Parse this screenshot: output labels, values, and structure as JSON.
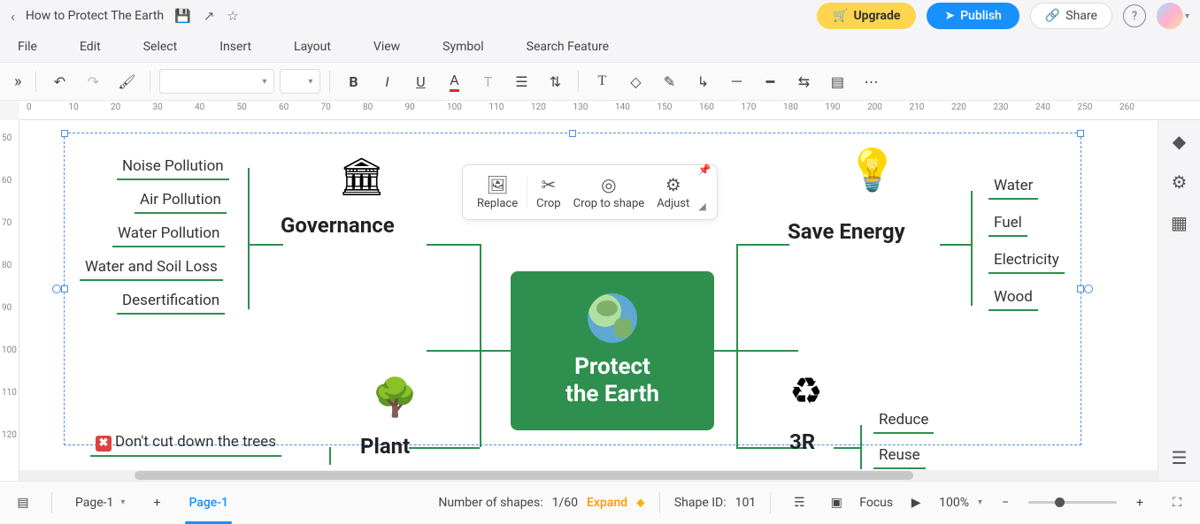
{
  "titlebar": {
    "doc_title": "How to Protect The Earth",
    "upgrade": "Upgrade",
    "publish": "Publish",
    "share": "Share"
  },
  "menu": {
    "file": "File",
    "edit": "Edit",
    "select": "Select",
    "insert": "Insert",
    "layout": "Layout",
    "view": "View",
    "symbol": "Symbol",
    "search": "Search Feature"
  },
  "ruler_h": [
    "0",
    "10",
    "20",
    "30",
    "40",
    "50",
    "60",
    "70",
    "80",
    "90",
    "100",
    "110",
    "120",
    "130",
    "140",
    "150",
    "160",
    "170",
    "180",
    "190",
    "200",
    "210",
    "220",
    "230",
    "240",
    "250",
    "260"
  ],
  "ruler_v": [
    "50",
    "60",
    "70",
    "80",
    "90",
    "100",
    "110",
    "120"
  ],
  "mindmap": {
    "central_line1": "Protect",
    "central_line2": "the Earth",
    "governance": {
      "label": "Governance",
      "items": [
        "Noise Pollution",
        "Air Pollution",
        "Water Pollution",
        "Water and Soil Loss",
        "Desertification"
      ]
    },
    "plant": {
      "label": "Plant",
      "items": [
        "Don't cut down the trees"
      ]
    },
    "save_energy": {
      "label": "Save Energy",
      "items": [
        "Water",
        "Fuel",
        "Electricity",
        "Wood"
      ]
    },
    "three_r": {
      "label": "3R",
      "items": [
        "Reduce",
        "Reuse"
      ]
    }
  },
  "img_toolbar": {
    "replace": "Replace",
    "crop": "Crop",
    "crop_to_shape": "Crop to shape",
    "adjust": "Adjust"
  },
  "status": {
    "page_selector": "Page-1",
    "page_tab": "Page-1",
    "shapes_label": "Number of shapes: ",
    "shapes_value": "1/60",
    "expand": "Expand",
    "shape_id_label": "Shape ID: ",
    "shape_id": "101",
    "focus": "Focus",
    "zoom": "100%"
  }
}
